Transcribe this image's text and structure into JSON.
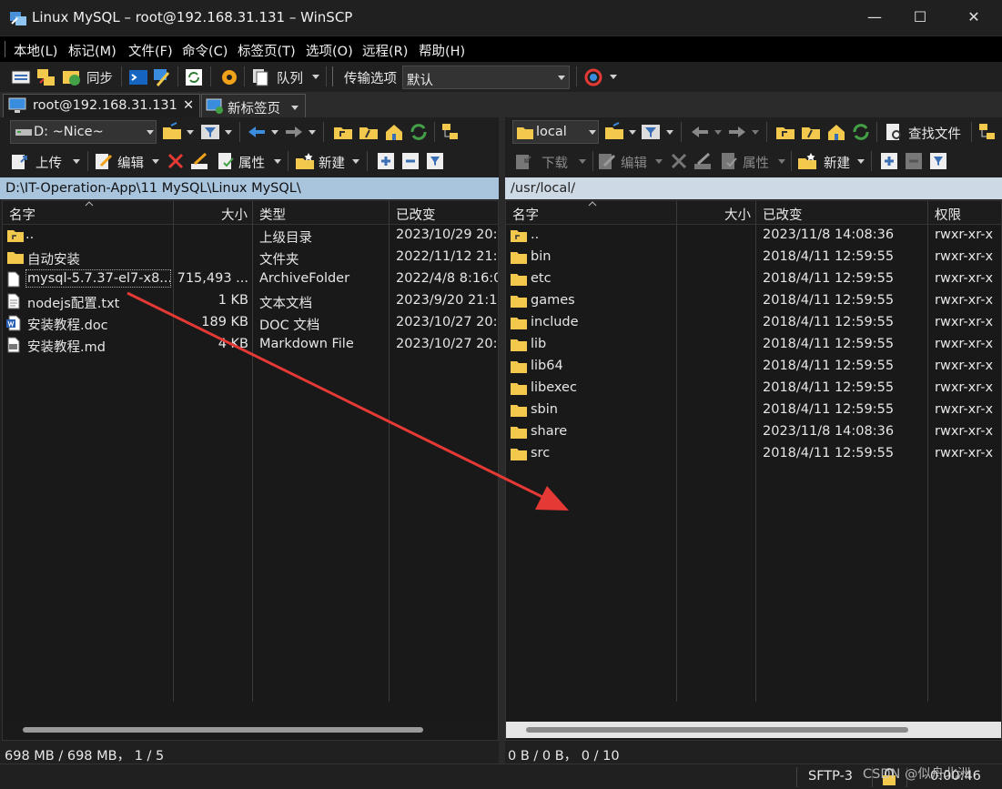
{
  "window": {
    "title": "Linux MySQL – root@192.168.31.131 – WinSCP",
    "minimize": "—",
    "maximize": "☐",
    "close": "✕"
  },
  "menu": [
    "本地(L)",
    "标记(M)",
    "文件(F)",
    "命令(C)",
    "标签页(T)",
    "选项(O)",
    "远程(R)",
    "帮助(H)"
  ],
  "toolbar": {
    "sync_label": "同步",
    "queue_label": "队列",
    "transfer_options_label": "传输选项",
    "transfer_preset": "默认"
  },
  "tabs": [
    {
      "label": "root@192.168.31.131",
      "close": "✕"
    },
    {
      "label": "新标签页"
    }
  ],
  "left": {
    "drive": "D: ~Nice~",
    "upload_label": "上传",
    "edit_label": "编辑",
    "properties_label": "属性",
    "new_label": "新建",
    "path": "D:\\IT-Operation-App\\11 MySQL\\Linux MySQL\\",
    "columns": [
      "名字",
      "大小",
      "类型",
      "已改变"
    ],
    "rows": [
      {
        "name": "..",
        "size": "",
        "type": "上级目录",
        "changed": "2023/10/29 20:",
        "icon": "parent-folder"
      },
      {
        "name": "自动安装",
        "size": "",
        "type": "文件夹",
        "changed": "2022/11/12 21:",
        "icon": "folder"
      },
      {
        "name": "mysql-5.7.37-el7-x8...",
        "size": "715,493 ...",
        "type": "ArchiveFolder",
        "changed": "2022/4/8 8:16:0",
        "icon": "file"
      },
      {
        "name": "nodejs配置.txt",
        "size": "1 KB",
        "type": "文本文档",
        "changed": "2023/9/20 21:1",
        "icon": "text-file"
      },
      {
        "name": "安装教程.doc",
        "size": "189 KB",
        "type": "DOC 文档",
        "changed": "2023/10/27 20:",
        "icon": "word-file"
      },
      {
        "name": "安装教程.md",
        "size": "4 KB",
        "type": "Markdown File",
        "changed": "2023/10/27 20:",
        "icon": "markdown-file"
      }
    ],
    "status": "698 MB / 698 MB，  1 / 5"
  },
  "right": {
    "dir": "local",
    "find_files_label": "查找文件",
    "download_label": "下载",
    "edit_label": "编辑",
    "properties_label": "属性",
    "new_label": "新建",
    "path": "/usr/local/",
    "columns": [
      "名字",
      "大小",
      "已改变",
      "权限"
    ],
    "rows": [
      {
        "name": "..",
        "changed": "2023/11/8 14:08:36",
        "rights": "rwxr-xr-x"
      },
      {
        "name": "bin",
        "changed": "2018/4/11 12:59:55",
        "rights": "rwxr-xr-x"
      },
      {
        "name": "etc",
        "changed": "2018/4/11 12:59:55",
        "rights": "rwxr-xr-x"
      },
      {
        "name": "games",
        "changed": "2018/4/11 12:59:55",
        "rights": "rwxr-xr-x"
      },
      {
        "name": "include",
        "changed": "2018/4/11 12:59:55",
        "rights": "rwxr-xr-x"
      },
      {
        "name": "lib",
        "changed": "2018/4/11 12:59:55",
        "rights": "rwxr-xr-x"
      },
      {
        "name": "lib64",
        "changed": "2018/4/11 12:59:55",
        "rights": "rwxr-xr-x"
      },
      {
        "name": "libexec",
        "changed": "2018/4/11 12:59:55",
        "rights": "rwxr-xr-x"
      },
      {
        "name": "sbin",
        "changed": "2018/4/11 12:59:55",
        "rights": "rwxr-xr-x"
      },
      {
        "name": "share",
        "changed": "2023/11/8 14:08:36",
        "rights": "rwxr-xr-x"
      },
      {
        "name": "src",
        "changed": "2018/4/11 12:59:55",
        "rights": "rwxr-xr-x"
      }
    ],
    "status": "0 B / 0 B，  0 / 10"
  },
  "bottom": {
    "protocol": "SFTP-3",
    "elapsed": "0:00:46",
    "watermark": "CSDN @似舟北洲"
  },
  "colors": {
    "folder": "#f2c94c",
    "active_path": "#a9c4dd",
    "arrow": "#e53935"
  }
}
